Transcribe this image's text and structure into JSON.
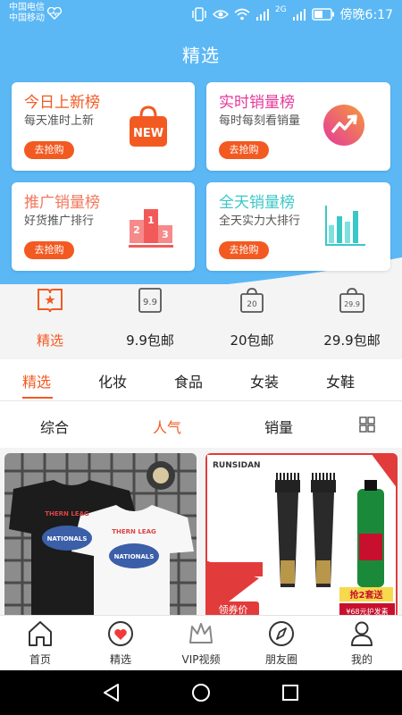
{
  "status_bar": {
    "carrier_1": "中国电信",
    "carrier_2": "中国移动",
    "signal_label": "2G",
    "time": "傍晚6:17"
  },
  "header": {
    "title": "精选"
  },
  "rank_cards": [
    {
      "title": "今日上新榜",
      "subtitle": "每天准时上新",
      "button": "去抢购",
      "title_color": "#f25a22",
      "icon": "shopping-bag-new-icon",
      "badge": "NEW"
    },
    {
      "title": "实时销量榜",
      "subtitle": "每时每刻看销量",
      "button": "去抢购",
      "title_color": "#e5399c",
      "icon": "trend-up-icon"
    },
    {
      "title": "推广销量榜",
      "subtitle": "好货推广排行",
      "button": "去抢购",
      "title_color": "#f2775a",
      "icon": "podium-icon",
      "badge_numbers": [
        "2",
        "1",
        "3"
      ]
    },
    {
      "title": "全天销量榜",
      "subtitle": "全天实力大排行",
      "button": "去抢购",
      "title_color": "#3cc7c7",
      "icon": "bar-chart-icon"
    }
  ],
  "categories": [
    {
      "label": "精选",
      "active": true,
      "icon": "book-star-icon"
    },
    {
      "label": "9.9包邮",
      "icon": "tag-99-icon",
      "icon_text": "9.9"
    },
    {
      "label": "20包邮",
      "icon": "bag-20-icon",
      "icon_text": "20"
    },
    {
      "label": "29.9包邮",
      "icon": "bag-299-icon",
      "icon_text": "29.9"
    }
  ],
  "tabs": [
    {
      "label": "精选",
      "active": true
    },
    {
      "label": "化妆"
    },
    {
      "label": "食品"
    },
    {
      "label": "女装"
    },
    {
      "label": "女鞋"
    }
  ],
  "sort_options": [
    {
      "label": "综合"
    },
    {
      "label": "人气",
      "active": true
    },
    {
      "label": "销量"
    }
  ],
  "products": [
    {
      "name": "t-shirt-product",
      "shirt_text_1": "THERN LEAG",
      "shirt_text_2": "NATIONALS"
    },
    {
      "name": "comb-dye-product",
      "brand": "RUNSIDAN",
      "promo_1": "领券价",
      "promo_2": "抢2套送",
      "promo_3": "¥68元护发素"
    }
  ],
  "bottom_nav": [
    {
      "label": "首页",
      "icon": "home-icon"
    },
    {
      "label": "精选",
      "icon": "heart-circle-icon",
      "active": true
    },
    {
      "label": "VIP视频",
      "icon": "crown-icon"
    },
    {
      "label": "朋友圈",
      "icon": "compass-icon"
    },
    {
      "label": "我的",
      "icon": "person-icon"
    }
  ],
  "colors": {
    "accent": "#f25a22",
    "header_blue": "#5bb8f5"
  }
}
